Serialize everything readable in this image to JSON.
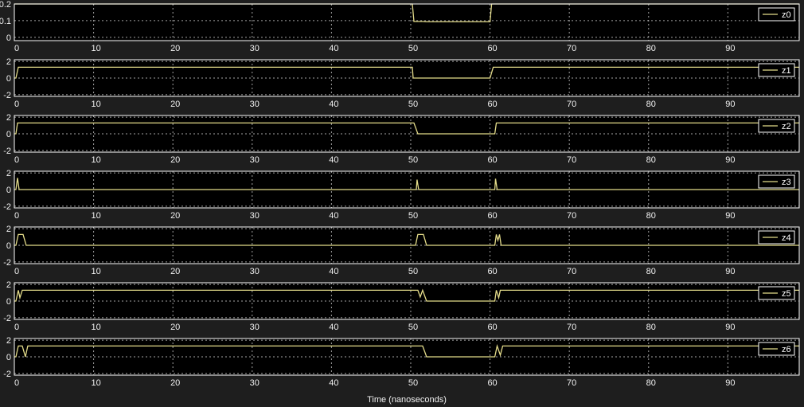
{
  "chart_data": [
    {
      "type": "line",
      "xlabel": "",
      "xlim": [
        0,
        99
      ],
      "ylim": [
        -0.02,
        0.2
      ],
      "yticks": [
        "0.2",
        "0.1",
        "0"
      ],
      "ytick_values": [
        0.2,
        0.1,
        0
      ],
      "xticks": [
        "0",
        "10",
        "20",
        "30",
        "40",
        "50",
        "60",
        "70",
        "80",
        "90"
      ],
      "series": [
        {
          "name": "z0",
          "x": [
            0,
            50.2,
            50.4,
            51.5,
            52,
            60,
            60.2,
            61,
            99
          ],
          "y": [
            0.2,
            0.2,
            0.095,
            0.095,
            0.093,
            0.093,
            0.2,
            0.2,
            0.2
          ]
        }
      ]
    },
    {
      "type": "line",
      "xlabel": "",
      "xlim": [
        0,
        99
      ],
      "ylim": [
        -2.2,
        2.2
      ],
      "yticks": [
        "2",
        "0",
        "-2"
      ],
      "ytick_values": [
        2,
        0,
        -2
      ],
      "xticks": [
        "0",
        "10",
        "20",
        "30",
        "40",
        "50",
        "60",
        "70",
        "80",
        "90"
      ],
      "series": [
        {
          "name": "z1",
          "x": [
            0,
            0.2,
            0.5,
            50.2,
            50.3,
            60,
            60.4,
            60.6,
            99
          ],
          "y": [
            0,
            0,
            1.3,
            1.3,
            0,
            0,
            1.3,
            1.3,
            1.3
          ]
        }
      ]
    },
    {
      "type": "line",
      "xlabel": "",
      "xlim": [
        0,
        99
      ],
      "ylim": [
        -2.2,
        2.2
      ],
      "yticks": [
        "2",
        "0",
        "-2"
      ],
      "ytick_values": [
        2,
        0,
        -2
      ],
      "xticks": [
        "0",
        "10",
        "20",
        "30",
        "40",
        "50",
        "60",
        "70",
        "80",
        "90"
      ],
      "series": [
        {
          "name": "z2",
          "x": [
            0,
            0.2,
            0.4,
            50.4,
            50.9,
            60.6,
            60.8,
            99
          ],
          "y": [
            0,
            0,
            1.3,
            1.3,
            0,
            0,
            1.3,
            1.3
          ]
        }
      ]
    },
    {
      "type": "line",
      "xlabel": "",
      "xlim": [
        0,
        99
      ],
      "ylim": [
        -2.2,
        2.2
      ],
      "yticks": [
        "2",
        "0",
        "-2"
      ],
      "ytick_values": [
        2,
        0,
        -2
      ],
      "xticks": [
        "0",
        "10",
        "20",
        "30",
        "40",
        "50",
        "60",
        "70",
        "80",
        "90"
      ],
      "series": [
        {
          "name": "z3",
          "x": [
            0,
            0.2,
            0.4,
            0.6,
            50.7,
            50.8,
            51,
            60.6,
            60.7,
            60.9,
            99
          ],
          "y": [
            0,
            0,
            1.4,
            0,
            0,
            1.2,
            0,
            0,
            1.3,
            0,
            0
          ]
        }
      ]
    },
    {
      "type": "line",
      "xlabel": "",
      "xlim": [
        0,
        99
      ],
      "ylim": [
        -2.2,
        2.2
      ],
      "yticks": [
        "2",
        "0",
        "-2"
      ],
      "ytick_values": [
        2,
        0,
        -2
      ],
      "xticks": [
        "0",
        "10",
        "20",
        "30",
        "40",
        "50",
        "60",
        "70",
        "80",
        "90"
      ],
      "series": [
        {
          "name": "z4",
          "x": [
            0,
            0.2,
            0.5,
            0.8,
            1.1,
            1.5,
            50.6,
            50.9,
            51.6,
            52,
            60.6,
            60.8,
            61,
            61.2,
            61.4,
            99
          ],
          "y": [
            0,
            0,
            1.3,
            1.3,
            1.3,
            0,
            0,
            1.3,
            1.3,
            0,
            0,
            1.3,
            0.6,
            1.3,
            0,
            0
          ]
        }
      ]
    },
    {
      "type": "line",
      "xlabel": "",
      "xlim": [
        0,
        99
      ],
      "ylim": [
        -2.2,
        2.2
      ],
      "yticks": [
        "2",
        "0",
        "-2"
      ],
      "ytick_values": [
        2,
        0,
        -2
      ],
      "xticks": [
        "0",
        "10",
        "20",
        "30",
        "40",
        "50",
        "60",
        "70",
        "80",
        "90"
      ],
      "series": [
        {
          "name": "z5",
          "x": [
            0,
            0.2,
            0.5,
            0.7,
            1,
            50.6,
            50.9,
            51.2,
            51.5,
            52,
            60.6,
            60.8,
            61.1,
            61.3,
            99
          ],
          "y": [
            0,
            0,
            1.3,
            0.4,
            1.3,
            1.3,
            1.3,
            0.5,
            1.3,
            0,
            0,
            1.3,
            0.4,
            1.3,
            1.3
          ]
        }
      ]
    },
    {
      "type": "line",
      "xlabel": "Time (nanoseconds)",
      "xlim": [
        0,
        99
      ],
      "ylim": [
        -2.2,
        2.2
      ],
      "yticks": [
        "2",
        "0",
        "-2"
      ],
      "ytick_values": [
        2,
        0,
        -2
      ],
      "xticks": [
        "0",
        "10",
        "20",
        "30",
        "40",
        "50",
        "60",
        "70",
        "80",
        "90"
      ],
      "series": [
        {
          "name": "z6",
          "x": [
            0,
            0.2,
            0.5,
            1,
            1.4,
            1.7,
            51.5,
            52,
            60.6,
            60.9,
            61.3,
            61.6,
            99
          ],
          "y": [
            0,
            0,
            1.3,
            1.3,
            0,
            1.3,
            1.3,
            0,
            0,
            1.3,
            0.2,
            1.3,
            1.3
          ]
        }
      ]
    }
  ],
  "colors": {
    "signal": "#e4dc8a",
    "background": "#000000",
    "axes": "#ffffff",
    "figure": "#1e1e1e"
  }
}
